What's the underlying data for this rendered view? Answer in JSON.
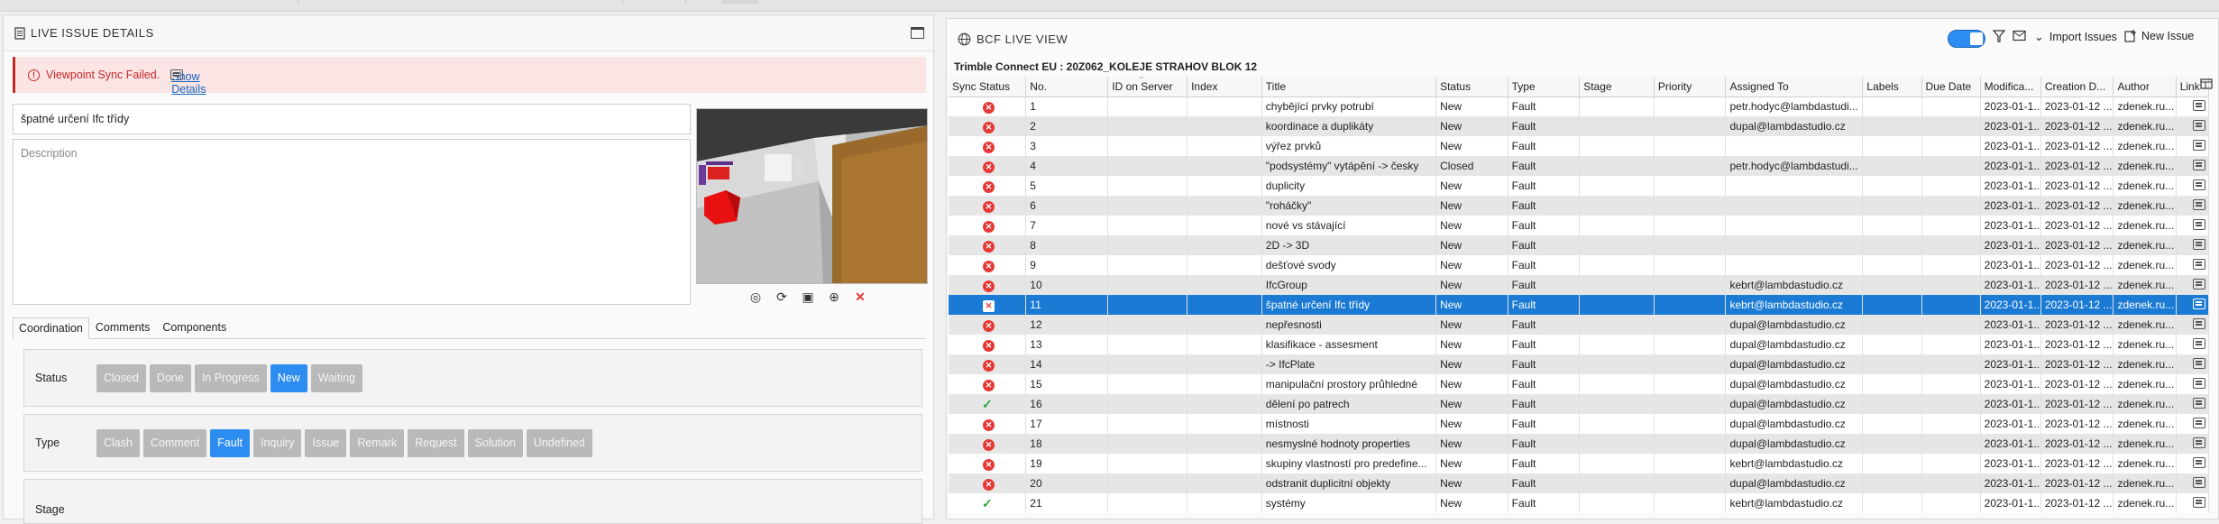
{
  "left_panel": {
    "title": "LIVE ISSUE DETAILS",
    "error": {
      "message": "Viewpoint Sync Failed.",
      "link": "Show Details"
    },
    "issue_title": "špatné určení Ifc třídy",
    "description_placeholder": "Description",
    "tabs": [
      "Coordination",
      "Comments",
      "Components"
    ],
    "status": {
      "label": "Status",
      "options": [
        "Closed",
        "Done",
        "In Progress",
        "New",
        "Waiting"
      ],
      "selected": "New"
    },
    "type": {
      "label": "Type",
      "options": [
        "Clash",
        "Comment",
        "Fault",
        "Inquiry",
        "Issue",
        "Remark",
        "Request",
        "Solution",
        "Undefined"
      ],
      "selected": "Fault"
    },
    "stage": {
      "label": "Stage"
    }
  },
  "right_panel": {
    "title": "BCF LIVE VIEW",
    "project": "Trimble Connect EU : 20Z062_KOLEJE STRAHOV BLOK 12",
    "import_label": "Import Issues",
    "new_issue_label": "New Issue",
    "columns": [
      "Sync Status",
      "No.",
      "ID on Server",
      "Index",
      "Title",
      "Status",
      "Type",
      "Stage",
      "Priority",
      "Assigned To",
      "Labels",
      "Due Date",
      "Modifica...",
      "Creation D...",
      "Author",
      "Link"
    ],
    "rows": [
      {
        "sync": "error",
        "no": "1",
        "title": "chybějící prvky potrubí",
        "status": "New",
        "type": "Fault",
        "assigned": "petr.hodyc@lambdastudi...",
        "mod": "2023-01-1...",
        "created": "2023-01-12 ...",
        "author": "zdenek.ru..."
      },
      {
        "sync": "error",
        "no": "2",
        "title": "koordinace a duplikáty",
        "status": "New",
        "type": "Fault",
        "assigned": "dupal@lambdastudio.cz",
        "mod": "2023-01-1...",
        "created": "2023-01-12 ...",
        "author": "zdenek.ru..."
      },
      {
        "sync": "error",
        "no": "3",
        "title": "výřez prvků",
        "status": "New",
        "type": "Fault",
        "assigned": "",
        "mod": "2023-01-1...",
        "created": "2023-01-12 ...",
        "author": "zdenek.ru..."
      },
      {
        "sync": "error",
        "no": "4",
        "title": "\"podsystémy\" vytápění -> česky",
        "status": "Closed",
        "type": "Fault",
        "assigned": "petr.hodyc@lambdastudi...",
        "mod": "2023-01-1...",
        "created": "2023-01-12 ...",
        "author": "zdenek.ru..."
      },
      {
        "sync": "error",
        "no": "5",
        "title": "duplicity",
        "status": "New",
        "type": "Fault",
        "assigned": "",
        "mod": "2023-01-1...",
        "created": "2023-01-12 ...",
        "author": "zdenek.ru..."
      },
      {
        "sync": "error",
        "no": "6",
        "title": "\"roháčky\"",
        "status": "New",
        "type": "Fault",
        "assigned": "",
        "mod": "2023-01-1...",
        "created": "2023-01-12 ...",
        "author": "zdenek.ru..."
      },
      {
        "sync": "error",
        "no": "7",
        "title": "nové vs stávající",
        "status": "New",
        "type": "Fault",
        "assigned": "",
        "mod": "2023-01-1...",
        "created": "2023-01-12 ...",
        "author": "zdenek.ru..."
      },
      {
        "sync": "error",
        "no": "8",
        "title": "2D -> 3D",
        "status": "New",
        "type": "Fault",
        "assigned": "",
        "mod": "2023-01-1...",
        "created": "2023-01-12 ...",
        "author": "zdenek.ru..."
      },
      {
        "sync": "error",
        "no": "9",
        "title": "dešťové svody",
        "status": "New",
        "type": "Fault",
        "assigned": "",
        "mod": "2023-01-1...",
        "created": "2023-01-12 ...",
        "author": "zdenek.ru..."
      },
      {
        "sync": "error",
        "no": "10",
        "title": "IfcGroup",
        "status": "New",
        "type": "Fault",
        "assigned": "kebrt@lambdastudio.cz",
        "mod": "2023-01-1...",
        "created": "2023-01-12 ...",
        "author": "zdenek.ru..."
      },
      {
        "sync": "error",
        "no": "11",
        "title": "špatné určení Ifc třídy",
        "status": "New",
        "type": "Fault",
        "assigned": "kebrt@lambdastudio.cz",
        "mod": "2023-01-1...",
        "created": "2023-01-12 ...",
        "author": "zdenek.ru...",
        "selected": true
      },
      {
        "sync": "error",
        "no": "12",
        "title": "nepřesnosti",
        "status": "New",
        "type": "Fault",
        "assigned": "dupal@lambdastudio.cz",
        "mod": "2023-01-1...",
        "created": "2023-01-12 ...",
        "author": "zdenek.ru..."
      },
      {
        "sync": "error",
        "no": "13",
        "title": "klasifikace - assesment",
        "status": "New",
        "type": "Fault",
        "assigned": "dupal@lambdastudio.cz",
        "mod": "2023-01-1...",
        "created": "2023-01-12 ...",
        "author": "zdenek.ru..."
      },
      {
        "sync": "error",
        "no": "14",
        "title": "-> IfcPlate",
        "status": "New",
        "type": "Fault",
        "assigned": "dupal@lambdastudio.cz",
        "mod": "2023-01-1...",
        "created": "2023-01-12 ...",
        "author": "zdenek.ru..."
      },
      {
        "sync": "error",
        "no": "15",
        "title": "manipulační prostory průhledné",
        "status": "New",
        "type": "Fault",
        "assigned": "dupal@lambdastudio.cz",
        "mod": "2023-01-1...",
        "created": "2023-01-12 ...",
        "author": "zdenek.ru..."
      },
      {
        "sync": "ok",
        "no": "16",
        "title": "dělení po patrech",
        "status": "New",
        "type": "Fault",
        "assigned": "dupal@lambdastudio.cz",
        "mod": "2023-01-1...",
        "created": "2023-01-12 ...",
        "author": "zdenek.ru..."
      },
      {
        "sync": "error",
        "no": "17",
        "title": "místnosti",
        "status": "New",
        "type": "Fault",
        "assigned": "dupal@lambdastudio.cz",
        "mod": "2023-01-1...",
        "created": "2023-01-12 ...",
        "author": "zdenek.ru..."
      },
      {
        "sync": "error",
        "no": "18",
        "title": "nesmyslné hodnoty properties",
        "status": "New",
        "type": "Fault",
        "assigned": "dupal@lambdastudio.cz",
        "mod": "2023-01-1...",
        "created": "2023-01-12 ...",
        "author": "zdenek.ru..."
      },
      {
        "sync": "error",
        "no": "19",
        "title": "skupiny vlastností pro predefine...",
        "status": "New",
        "type": "Fault",
        "assigned": "kebrt@lambdastudio.cz",
        "mod": "2023-01-1...",
        "created": "2023-01-12 ...",
        "author": "zdenek.ru..."
      },
      {
        "sync": "error",
        "no": "20",
        "title": "odstranit duplicitní objekty",
        "status": "New",
        "type": "Fault",
        "assigned": "dupal@lambdastudio.cz",
        "mod": "2023-01-1...",
        "created": "2023-01-12 ...",
        "author": "zdenek.ru..."
      },
      {
        "sync": "ok",
        "no": "21",
        "title": "systémy",
        "status": "New",
        "type": "Fault",
        "assigned": "kebrt@lambdastudio.cz",
        "mod": "2023-01-1...",
        "created": "2023-01-12 ...",
        "author": "zdenek.ru..."
      }
    ]
  },
  "colors": {
    "accent": "#2d8cf0",
    "selected_row": "#1a7ad4",
    "error": "#e53935",
    "ok": "#2eaa3a"
  }
}
